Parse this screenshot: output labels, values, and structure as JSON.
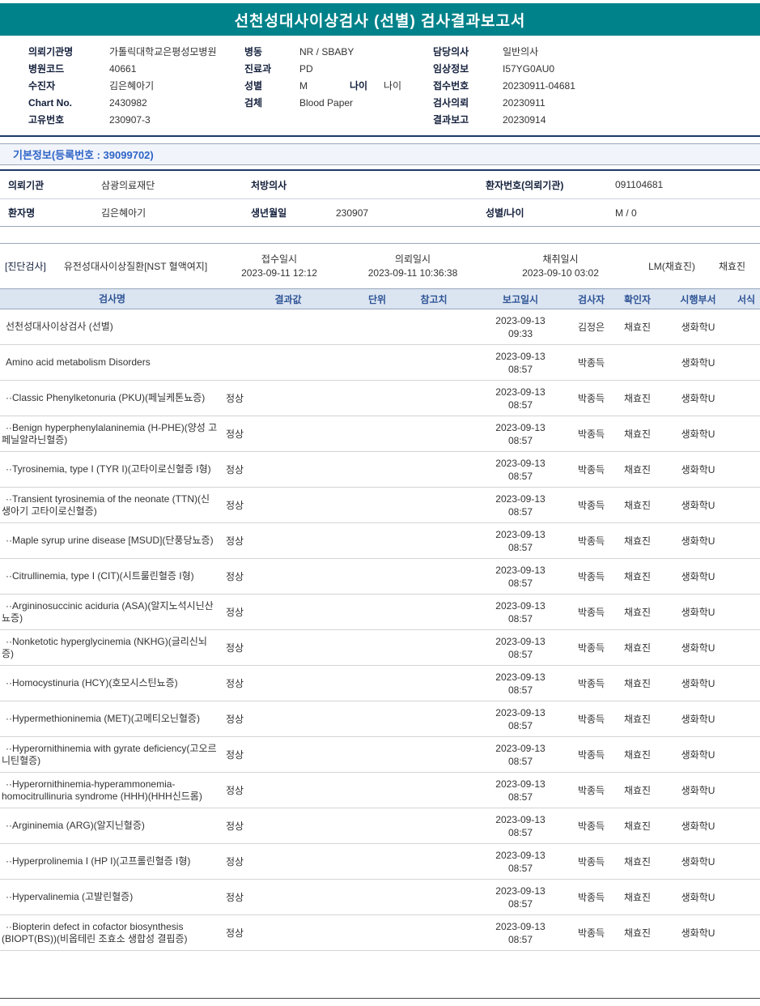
{
  "report": {
    "title": "선천성대사이상검사 (선별) 검사결과보고서"
  },
  "header": {
    "left": [
      {
        "label": "의뢰기관명",
        "value": "가톨릭대학교은평성모병원"
      },
      {
        "label": "병원코드",
        "value": "40661"
      },
      {
        "label": "수진자",
        "value": "김은혜아기"
      },
      {
        "label": "Chart No.",
        "value": "2430982"
      },
      {
        "label": "고유번호",
        "value": "230907-3"
      }
    ],
    "middle": {
      "ward_label": "병동",
      "ward_value": "NR / SBABY",
      "dept_label": "진료과",
      "dept_value": "PD",
      "gender_label": "성별",
      "gender_value": "M",
      "age_label": "나이",
      "age_value": "나이",
      "specimen_label": "검체",
      "specimen_value": "Blood Paper"
    },
    "right": [
      {
        "label": "담당의사",
        "value": "일반의사"
      },
      {
        "label": "임상정보",
        "value": "I57YG0AU0"
      },
      {
        "label": "접수번호",
        "value": "20230911-04681"
      },
      {
        "label": "검사의뢰",
        "value": "20230911"
      },
      {
        "label": "결과보고",
        "value": "20230914"
      }
    ]
  },
  "basic_info": {
    "section_title": "기본정보(등록번호 : 39099702)",
    "row1": {
      "l1": "의뢰기관",
      "v1": "삼광의료재단",
      "l2": "처방의사",
      "v2": "",
      "l3": "환자번호(의뢰기관)",
      "v3": "091104681"
    },
    "row2": {
      "l1": "환자명",
      "v1": "김은혜아기",
      "l2": "생년월일",
      "v2": "230907",
      "l3": "성별/나이",
      "v3": "M / 0"
    }
  },
  "order": {
    "tag": "[진단검사]",
    "test_name": "유전성대사이상질환[NST 혈액여지]",
    "receipt_label": "접수일시",
    "receipt_value": "2023-09-11 12:12",
    "request_label": "의뢰일시",
    "request_value": "2023-09-11 10:36:38",
    "collect_label": "채취일시",
    "collect_value": "2023-09-10 03:02",
    "collector": "LM(채효진)",
    "confirmer": "채효진"
  },
  "results": {
    "headers": [
      "검사명",
      "결과값",
      "단위",
      "참고치",
      "보고일시",
      "검사자",
      "확인자",
      "시행부서",
      "서식"
    ],
    "rows": [
      {
        "name": "선천성대사이상검사 (선별)",
        "result": "",
        "unit": "",
        "ref": "",
        "reported": "2023-09-13 09:33",
        "tester": "김정은",
        "confirmer": "채효진",
        "dept": "생화학U",
        "form": ""
      },
      {
        "name": "Amino acid metabolism Disorders",
        "result": "",
        "unit": "",
        "ref": "",
        "reported": "2023-09-13 08:57",
        "tester": "박종득",
        "confirmer": "",
        "dept": "생화학U",
        "form": ""
      },
      {
        "name": "··Classic Phenylketonuria (PKU)(페닐케톤뇨증)",
        "result": "정상",
        "unit": "",
        "ref": "",
        "reported": "2023-09-13 08:57",
        "tester": "박종득",
        "confirmer": "채효진",
        "dept": "생화학U",
        "form": ""
      },
      {
        "name": "··Benign hyperphenylalaninemia (H-PHE)(양성 고페닐알라닌혈증)",
        "result": "정상",
        "unit": "",
        "ref": "",
        "reported": "2023-09-13 08:57",
        "tester": "박종득",
        "confirmer": "채효진",
        "dept": "생화학U",
        "form": ""
      },
      {
        "name": "··Tyrosinemia, type I (TYR I)(고타이로신혈증 I형)",
        "result": "정상",
        "unit": "",
        "ref": "",
        "reported": "2023-09-13 08:57",
        "tester": "박종득",
        "confirmer": "채효진",
        "dept": "생화학U",
        "form": ""
      },
      {
        "name": "··Transient tyrosinemia of the neonate (TTN)(신생아기 고타이로신혈증)",
        "result": "정상",
        "unit": "",
        "ref": "",
        "reported": "2023-09-13 08:57",
        "tester": "박종득",
        "confirmer": "채효진",
        "dept": "생화학U",
        "form": ""
      },
      {
        "name": "··Maple syrup urine disease [MSUD](단풍당뇨증)",
        "result": "정상",
        "unit": "",
        "ref": "",
        "reported": "2023-09-13 08:57",
        "tester": "박종득",
        "confirmer": "채효진",
        "dept": "생화학U",
        "form": ""
      },
      {
        "name": "··Citrullinemia, type I (CIT)(시트룰린혈증 I형)",
        "result": "정상",
        "unit": "",
        "ref": "",
        "reported": "2023-09-13 08:57",
        "tester": "박종득",
        "confirmer": "채효진",
        "dept": "생화학U",
        "form": ""
      },
      {
        "name": "··Argininosuccinic aciduria (ASA)(알지노석시닌산뇨증)",
        "result": "정상",
        "unit": "",
        "ref": "",
        "reported": "2023-09-13 08:57",
        "tester": "박종득",
        "confirmer": "채효진",
        "dept": "생화학U",
        "form": ""
      },
      {
        "name": "··Nonketotic hyperglycinemia (NKHG)(글리신뇌증)",
        "result": "정상",
        "unit": "",
        "ref": "",
        "reported": "2023-09-13 08:57",
        "tester": "박종득",
        "confirmer": "채효진",
        "dept": "생화학U",
        "form": ""
      },
      {
        "name": "··Homocystinuria (HCY)(호모시스틴뇨증)",
        "result": "정상",
        "unit": "",
        "ref": "",
        "reported": "2023-09-13 08:57",
        "tester": "박종득",
        "confirmer": "채효진",
        "dept": "생화학U",
        "form": ""
      },
      {
        "name": "··Hypermethioninemia (MET)(고메티오닌혈증)",
        "result": "정상",
        "unit": "",
        "ref": "",
        "reported": "2023-09-13 08:57",
        "tester": "박종득",
        "confirmer": "채효진",
        "dept": "생화학U",
        "form": ""
      },
      {
        "name": "··Hyperornithinemia with gyrate deficiency(고오르니틴혈증)",
        "result": "정상",
        "unit": "",
        "ref": "",
        "reported": "2023-09-13 08:57",
        "tester": "박종득",
        "confirmer": "채효진",
        "dept": "생화학U",
        "form": ""
      },
      {
        "name": "··Hyperornithinemia-hyperammonemia-homocitrullinuria syndrome (HHH)(HHH신드롬)",
        "result": "정상",
        "unit": "",
        "ref": "",
        "reported": "2023-09-13 08:57",
        "tester": "박종득",
        "confirmer": "채효진",
        "dept": "생화학U",
        "form": ""
      },
      {
        "name": "··Argininemia (ARG)(알지닌혈증)",
        "result": "정상",
        "unit": "",
        "ref": "",
        "reported": "2023-09-13 08:57",
        "tester": "박종득",
        "confirmer": "채효진",
        "dept": "생화학U",
        "form": ""
      },
      {
        "name": "··Hyperprolinemia I (HP I)(고프롤린혈증 I형)",
        "result": "정상",
        "unit": "",
        "ref": "",
        "reported": "2023-09-13 08:57",
        "tester": "박종득",
        "confirmer": "채효진",
        "dept": "생화학U",
        "form": ""
      },
      {
        "name": "··Hypervalinemia (고발린혈증)",
        "result": "정상",
        "unit": "",
        "ref": "",
        "reported": "2023-09-13 08:57",
        "tester": "박종득",
        "confirmer": "채효진",
        "dept": "생화학U",
        "form": ""
      },
      {
        "name": "··Biopterin defect in cofactor biosynthesis (BIOPT(BS))(비옵테린 조효소 생합성 결핍증)",
        "result": "정상",
        "unit": "",
        "ref": "",
        "reported": "2023-09-13 08:57",
        "tester": "박종득",
        "confirmer": "채효진",
        "dept": "생화학U",
        "form": ""
      }
    ]
  }
}
